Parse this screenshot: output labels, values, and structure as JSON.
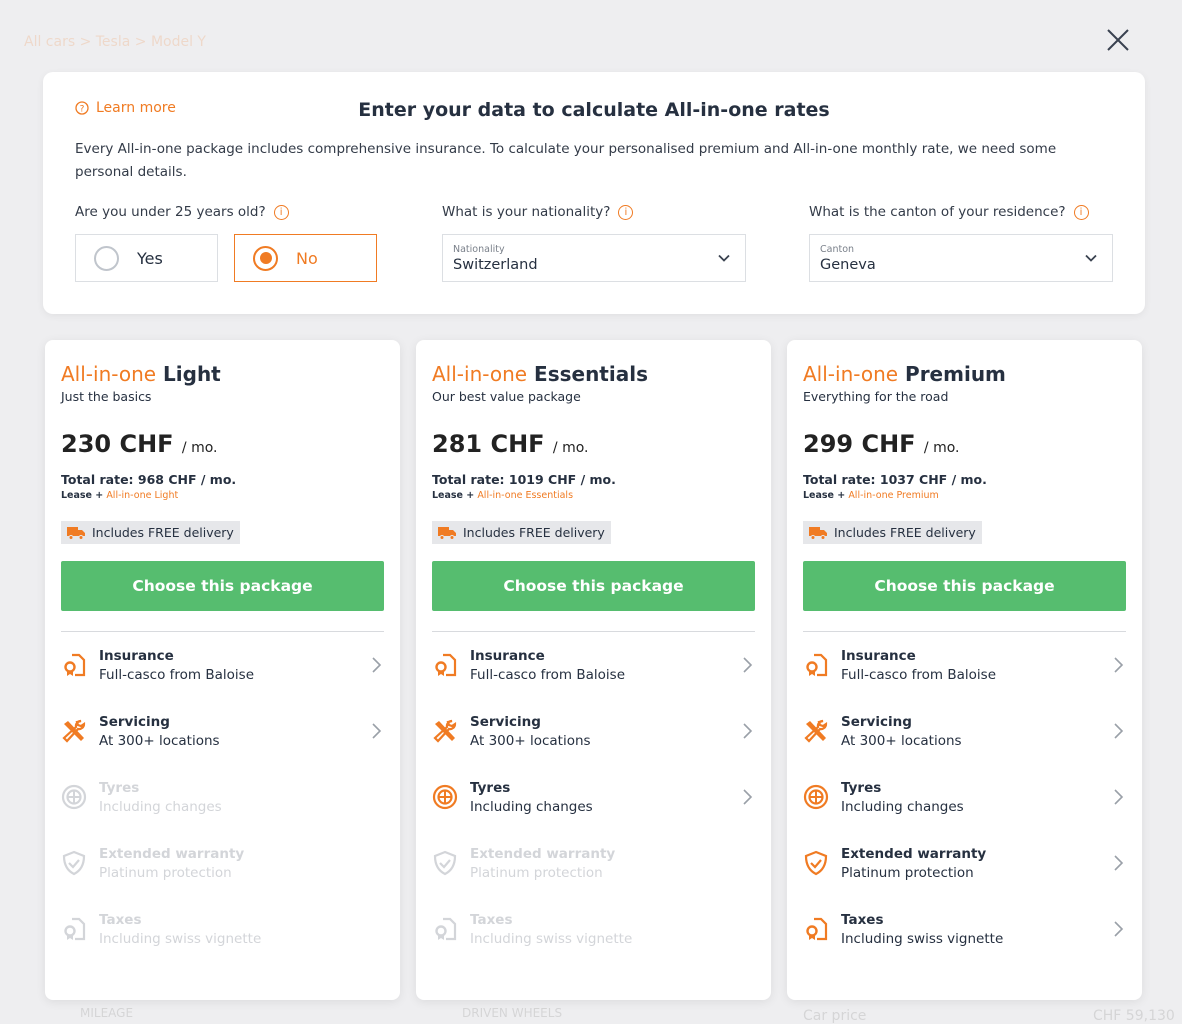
{
  "background": {
    "breadcrumb": "All cars  >  Tesla  >  Model Y",
    "mileage": "MILEAGE",
    "driven_wheels": "DRIVEN WHEELS",
    "car_price": "Car price",
    "car_price_value": "CHF 59,130"
  },
  "colors": {
    "accent": "#f07b23",
    "button": "#56bd6f",
    "disabled": "#d3d5d9"
  },
  "panel": {
    "learn_more": "Learn more",
    "title": "Enter your data to calculate All-in-one rates",
    "description": "Every All-in-one package includes comprehensive insurance. To calculate your personalised premium and All-in-one monthly rate, we need some personal details.",
    "age_question": "Are you under 25 years old?",
    "age_options": [
      "Yes",
      "No"
    ],
    "age_selected": "No",
    "nationality_question": "What is your nationality?",
    "nationality_label": "Nationality",
    "nationality_value": "Switzerland",
    "canton_question": "What is the canton of your residence?",
    "canton_label": "Canton",
    "canton_value": "Geneva"
  },
  "cards": [
    {
      "brand": "All-in-one",
      "name": "Light",
      "subtitle": "Just the basics",
      "price": "230 CHF",
      "per": "/ mo.",
      "total": "Total rate: 968 CHF / mo.",
      "lease": "Lease +",
      "lease_pkg": "All-in-one Light",
      "delivery": "Includes FREE delivery",
      "cta": "Choose this package",
      "features_enabled": [
        true,
        true,
        false,
        false,
        false
      ]
    },
    {
      "brand": "All-in-one",
      "name": "Essentials",
      "subtitle": "Our best value package",
      "price": "281 CHF",
      "per": "/ mo.",
      "total": "Total rate: 1019 CHF / mo.",
      "lease": "Lease +",
      "lease_pkg": "All-in-one Essentials",
      "delivery": "Includes FREE delivery",
      "cta": "Choose this package",
      "features_enabled": [
        true,
        true,
        true,
        false,
        false
      ]
    },
    {
      "brand": "All-in-one",
      "name": "Premium",
      "subtitle": "Everything for the road",
      "price": "299 CHF",
      "per": "/ mo.",
      "total": "Total rate: 1037 CHF / mo.",
      "lease": "Lease +",
      "lease_pkg": "All-in-one Premium",
      "delivery": "Includes FREE delivery",
      "cta": "Choose this package",
      "features_enabled": [
        true,
        true,
        true,
        true,
        true
      ]
    }
  ],
  "features": [
    {
      "title": "Insurance",
      "desc": "Full-casco from Baloise",
      "icon": "insurance-doc-icon"
    },
    {
      "title": "Servicing",
      "desc": "At 300+ locations",
      "icon": "tools-icon"
    },
    {
      "title": "Tyres",
      "desc": "Including changes",
      "icon": "tyre-icon"
    },
    {
      "title": "Extended warranty",
      "desc": "Platinum protection",
      "icon": "shield-check-icon"
    },
    {
      "title": "Taxes",
      "desc": "Including swiss vignette",
      "icon": "tax-doc-icon"
    }
  ]
}
